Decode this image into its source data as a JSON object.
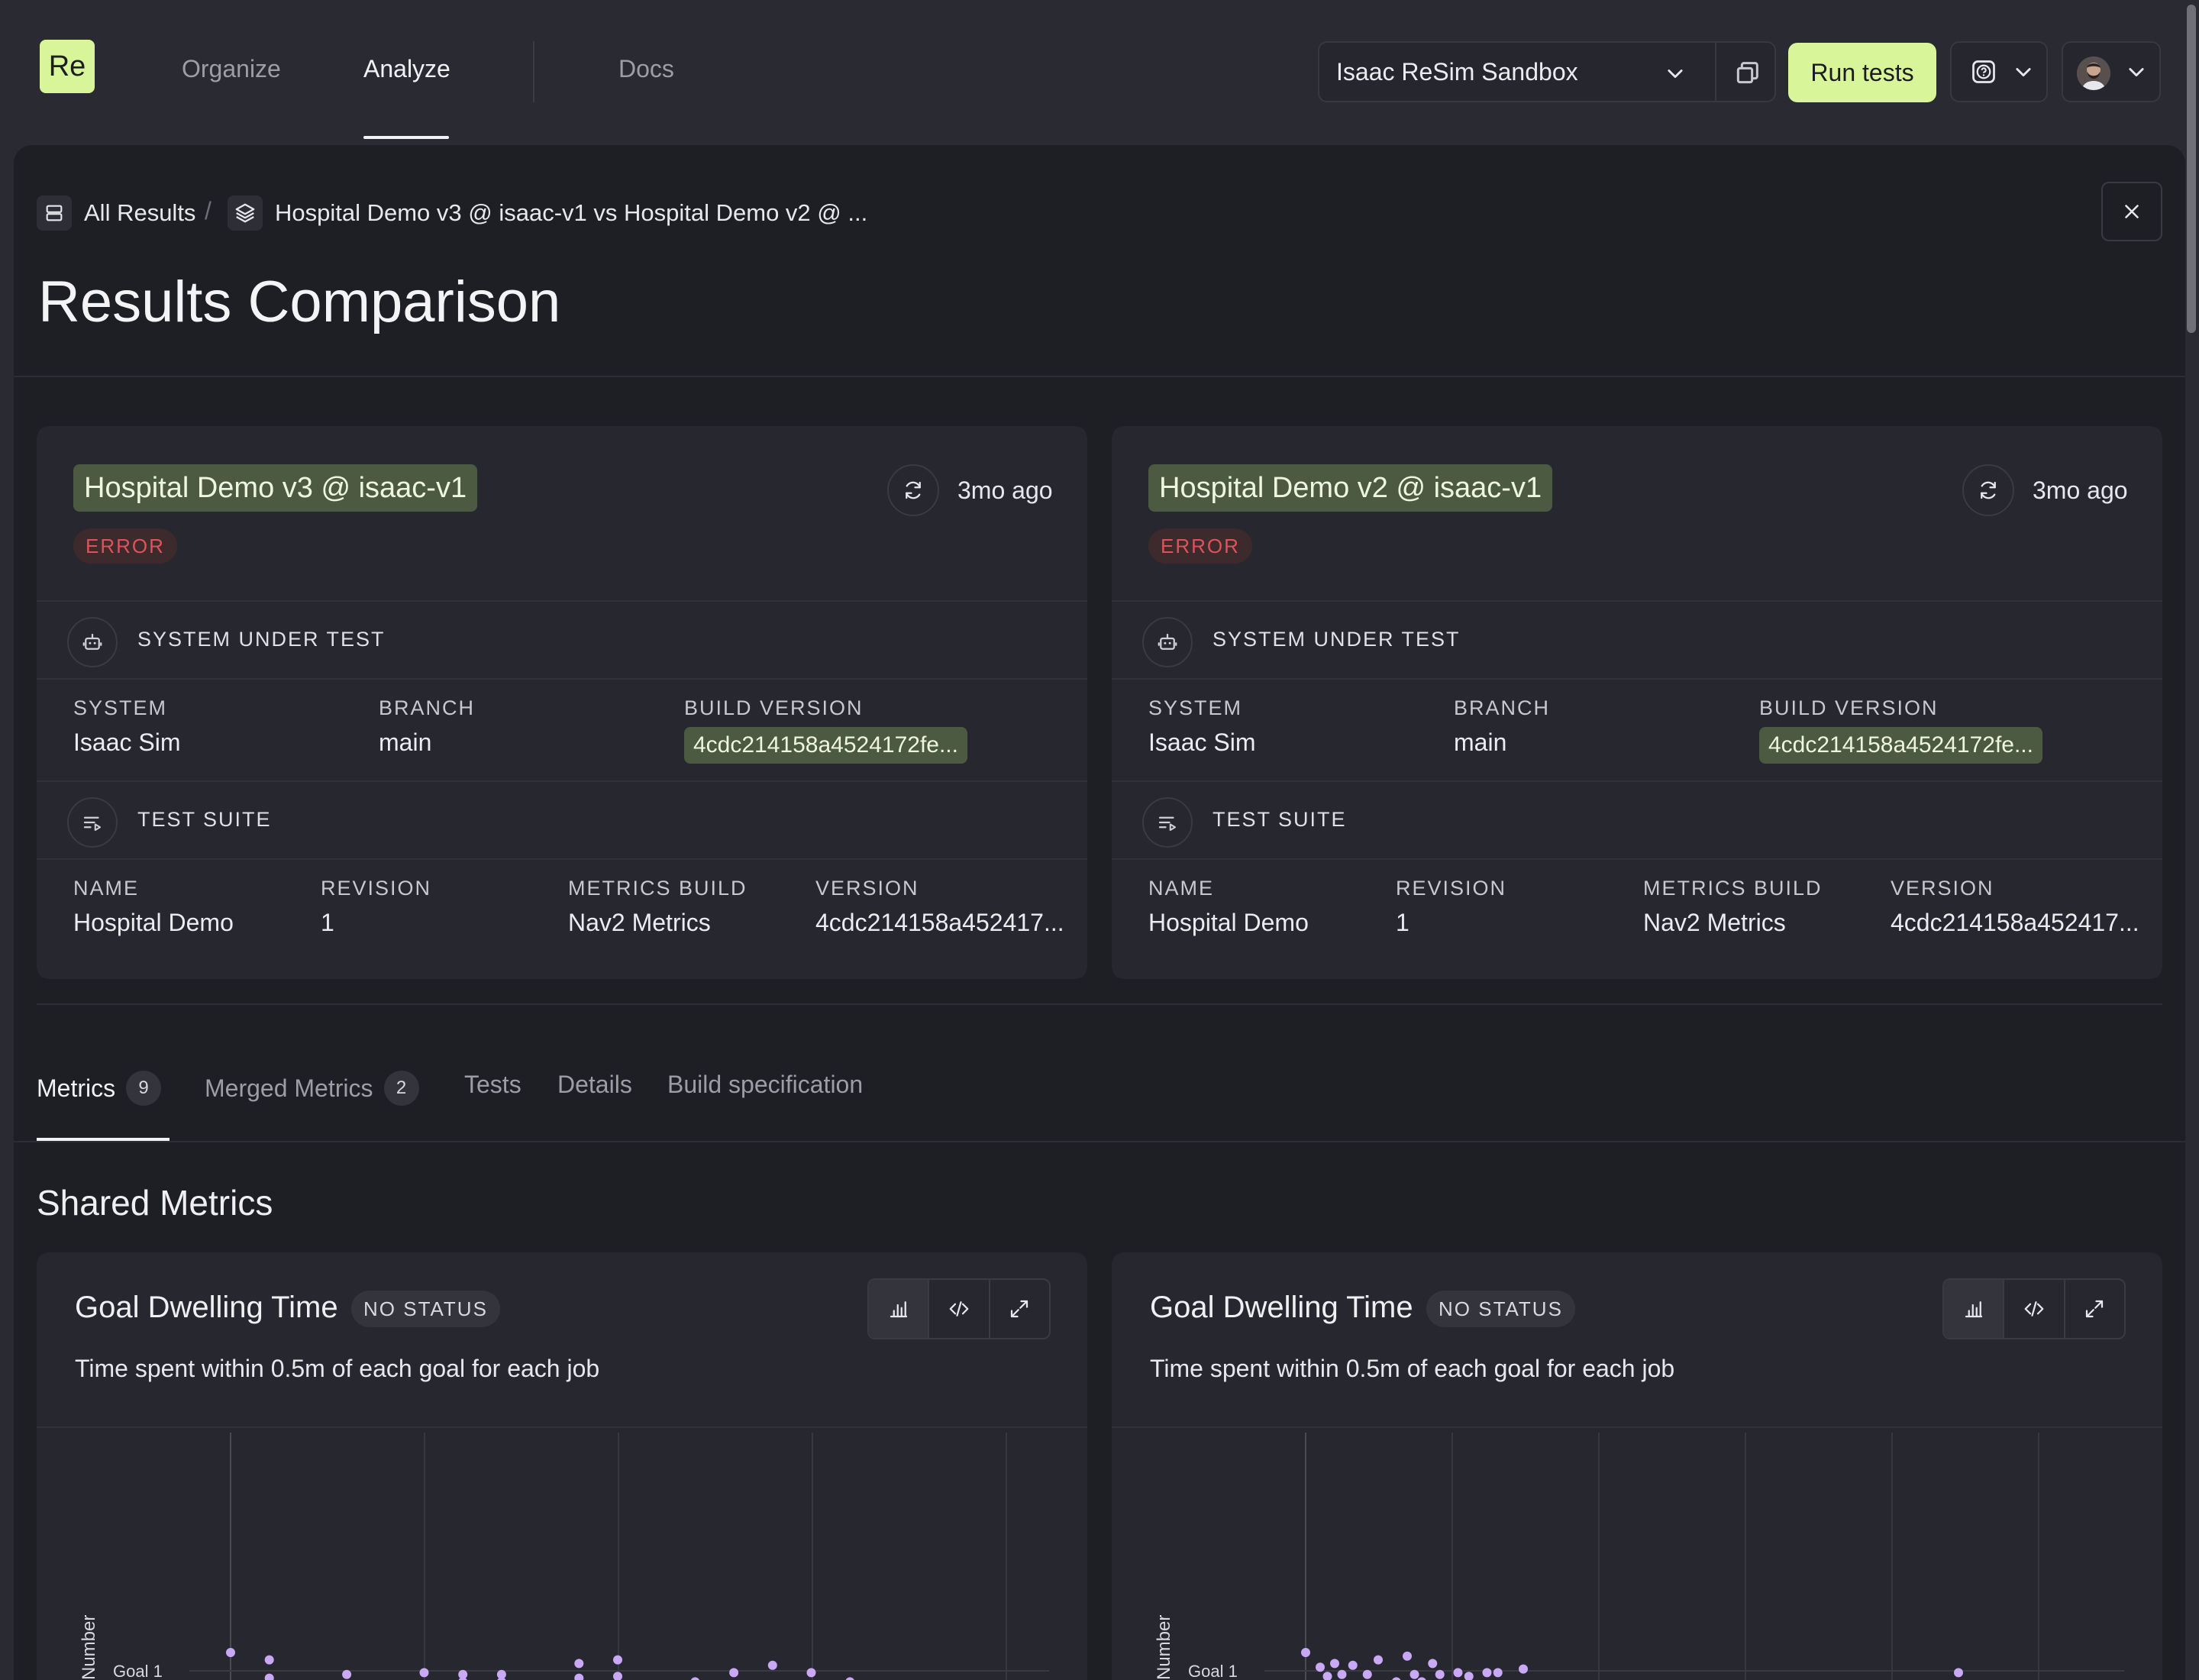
{
  "nav": {
    "logo": "Re",
    "items": [
      {
        "label": "Organize",
        "active": false
      },
      {
        "label": "Analyze",
        "active": true
      },
      {
        "label": "Docs",
        "active": false
      }
    ],
    "project": "Isaac ReSim Sandbox",
    "run_button": "Run tests"
  },
  "breadcrumb": {
    "root": "All Results",
    "separator": "/",
    "current": "Hospital Demo v3 @ isaac-v1 vs Hospital Demo v2 @ ..."
  },
  "page_title": "Results Comparison",
  "results": [
    {
      "title": "Hospital Demo v3 @ isaac-v1",
      "status": "ERROR",
      "time_ago": "3mo ago",
      "sut": {
        "section_label": "SYSTEM UNDER TEST",
        "system_label": "SYSTEM",
        "system": "Isaac Sim",
        "branch_label": "BRANCH",
        "branch": "main",
        "build_label": "BUILD VERSION",
        "build": "4cdc214158a4524172fe..."
      },
      "suite": {
        "section_label": "TEST SUITE",
        "name_label": "NAME",
        "name": "Hospital Demo",
        "revision_label": "REVISION",
        "revision": "1",
        "metrics_label": "METRICS BUILD",
        "metrics": "Nav2 Metrics",
        "version_label": "VERSION",
        "version": "4cdc214158a452417..."
      }
    },
    {
      "title": "Hospital Demo v2 @ isaac-v1",
      "status": "ERROR",
      "time_ago": "3mo ago",
      "sut": {
        "section_label": "SYSTEM UNDER TEST",
        "system_label": "SYSTEM",
        "system": "Isaac Sim",
        "branch_label": "BRANCH",
        "branch": "main",
        "build_label": "BUILD VERSION",
        "build": "4cdc214158a4524172fe..."
      },
      "suite": {
        "section_label": "TEST SUITE",
        "name_label": "NAME",
        "name": "Hospital Demo",
        "revision_label": "REVISION",
        "revision": "1",
        "metrics_label": "METRICS BUILD",
        "metrics": "Nav2 Metrics",
        "version_label": "VERSION",
        "version": "4cdc214158a452417..."
      }
    }
  ],
  "tabs": [
    {
      "label": "Metrics",
      "count": "9",
      "active": true
    },
    {
      "label": "Merged Metrics",
      "count": "2",
      "active": false
    },
    {
      "label": "Tests",
      "active": false
    },
    {
      "label": "Details",
      "active": false
    },
    {
      "label": "Build specification",
      "active": false
    }
  ],
  "section_title": "Shared Metrics",
  "metric_cards": [
    {
      "title": "Goal Dwelling Time",
      "status": "NO STATUS",
      "description": "Time spent within 0.5m of each goal for each job"
    },
    {
      "title": "Goal Dwelling Time",
      "status": "NO STATUS",
      "description": "Time spent within 0.5m of each goal for each job"
    }
  ],
  "chart_data": [
    {
      "type": "scatter",
      "title": "",
      "ylabel": "Number",
      "y_categories": [
        "Goal 1"
      ],
      "x": [
        0,
        1,
        1,
        3,
        5,
        6,
        6,
        7,
        7,
        9,
        9,
        10,
        10,
        11,
        12,
        13,
        14,
        15,
        16,
        20
      ],
      "y_offset": [
        1,
        0.6,
        -0.4,
        -0.2,
        -0.1,
        -0.6,
        -0.2,
        -0.6,
        -0.2,
        0.4,
        -0.4,
        0.6,
        -0.3,
        -0.8,
        -0.6,
        -0.1,
        0.3,
        -0.1,
        -0.6,
        -0.8
      ],
      "color": "#c9a8f5"
    },
    {
      "type": "scatter",
      "title": "",
      "ylabel": "Number",
      "y_categories": [
        "Goal 1"
      ],
      "x": [
        0,
        0.4,
        0.6,
        0.8,
        1,
        1.3,
        1.7,
        2,
        2.5,
        2.8,
        3,
        3.2,
        3.5,
        3.7,
        4.2,
        4.5,
        5,
        5.3,
        6,
        18
      ],
      "y_offset": [
        1,
        0.2,
        -0.3,
        0.4,
        -0.2,
        0.3,
        -0.2,
        0.6,
        -0.6,
        0.8,
        -0.2,
        -0.6,
        0.4,
        -0.2,
        -0.1,
        -0.3,
        -0.1,
        -0.1,
        0.1,
        -0.1
      ],
      "color": "#c9a8f5"
    }
  ],
  "colors": {
    "accent": "#d8f59a",
    "error": "#e0525a",
    "chip_green": "#4b5a40",
    "point": "#c9a8f5"
  }
}
